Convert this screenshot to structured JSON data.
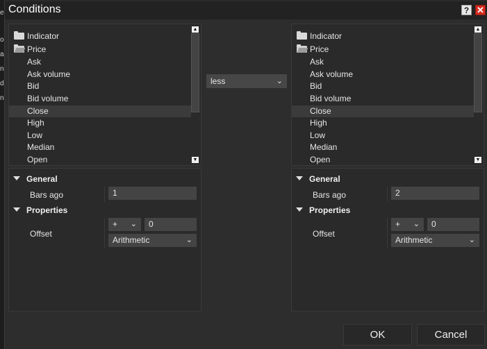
{
  "dialog": {
    "title": "Conditions",
    "help": "?",
    "close": "✕"
  },
  "background_fragments": [
    "e",
    "o",
    "al",
    "nd",
    "di",
    "nd"
  ],
  "left": {
    "tree": {
      "folders": [
        {
          "label": "Indicator",
          "open": false
        },
        {
          "label": "Price",
          "open": true
        }
      ],
      "items": [
        "Ask",
        "Ask volume",
        "Bid",
        "Bid volume",
        "Close",
        "High",
        "Low",
        "Median",
        "Open"
      ],
      "selected": "Close"
    },
    "props": {
      "general_label": "General",
      "bars_ago_label": "Bars ago",
      "bars_ago_value": "1",
      "properties_label": "Properties",
      "offset_label": "Offset",
      "offset_sign": "+",
      "offset_value": "0",
      "offset_type": "Arithmetic"
    }
  },
  "operator": {
    "value": "less"
  },
  "right": {
    "tree": {
      "folders": [
        {
          "label": "Indicator",
          "open": false
        },
        {
          "label": "Price",
          "open": true
        }
      ],
      "items": [
        "Ask",
        "Ask volume",
        "Bid",
        "Bid volume",
        "Close",
        "High",
        "Low",
        "Median",
        "Open"
      ],
      "selected": "Close"
    },
    "props": {
      "general_label": "General",
      "bars_ago_label": "Bars ago",
      "bars_ago_value": "2",
      "properties_label": "Properties",
      "offset_label": "Offset",
      "offset_sign": "+",
      "offset_value": "0",
      "offset_type": "Arithmetic"
    }
  },
  "buttons": {
    "ok": "OK",
    "cancel": "Cancel"
  },
  "icons": {
    "scroll_up": "▲",
    "scroll_down": "▼",
    "chevron": "❯",
    "triangle": "▼"
  }
}
